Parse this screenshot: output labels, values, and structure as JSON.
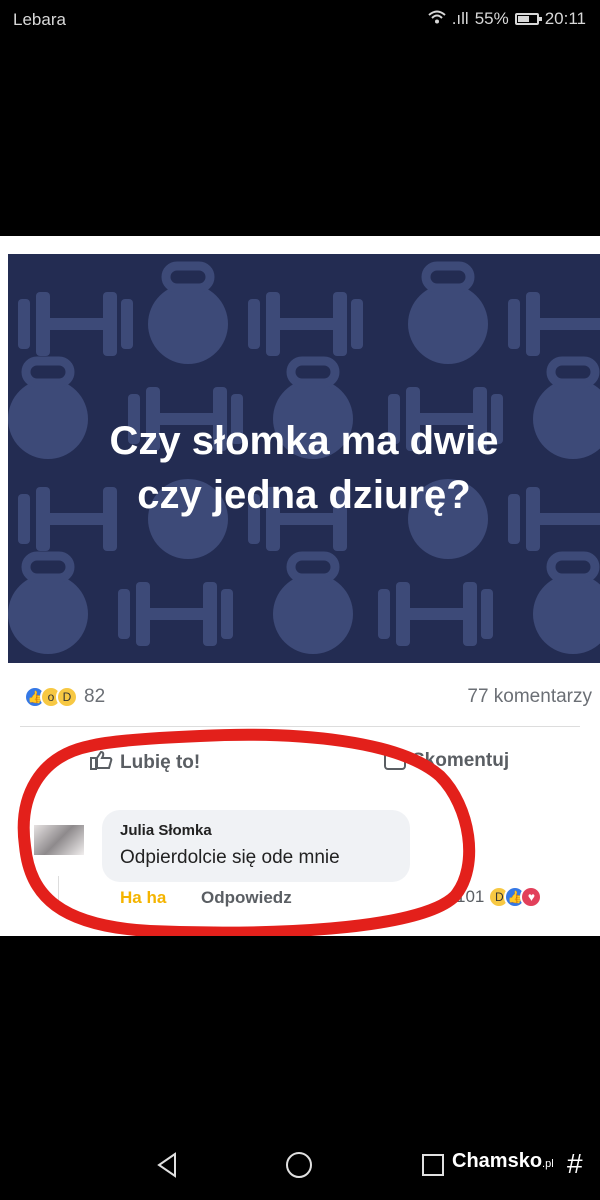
{
  "status_bar": {
    "carrier": "Lebara",
    "signal_text": ".ıll",
    "battery": "55%",
    "time": "20:11"
  },
  "post": {
    "image_text_line1": "Czy słomka ma dwie",
    "image_text_line2": "czy jedna dziurę?",
    "reaction_count": "82",
    "comments_count": "77 komentarzy",
    "actions": {
      "like": "Lubię to!",
      "comment": "Skomentuj"
    }
  },
  "comment": {
    "author": "Julia Słomka",
    "text": "Odpierdolcie się ode mnie",
    "haha_label": "Ha ha",
    "reply_label": "Odpowiedz",
    "reaction_count": "101"
  },
  "watermark": {
    "brand": "Chamsko",
    "suffix": ".pl",
    "symbol": "#"
  },
  "colors": {
    "banner_bg": "#232c52",
    "shape": "#3d4a78",
    "accent_red": "#e3201b",
    "facebook_blue": "#3578e5"
  }
}
